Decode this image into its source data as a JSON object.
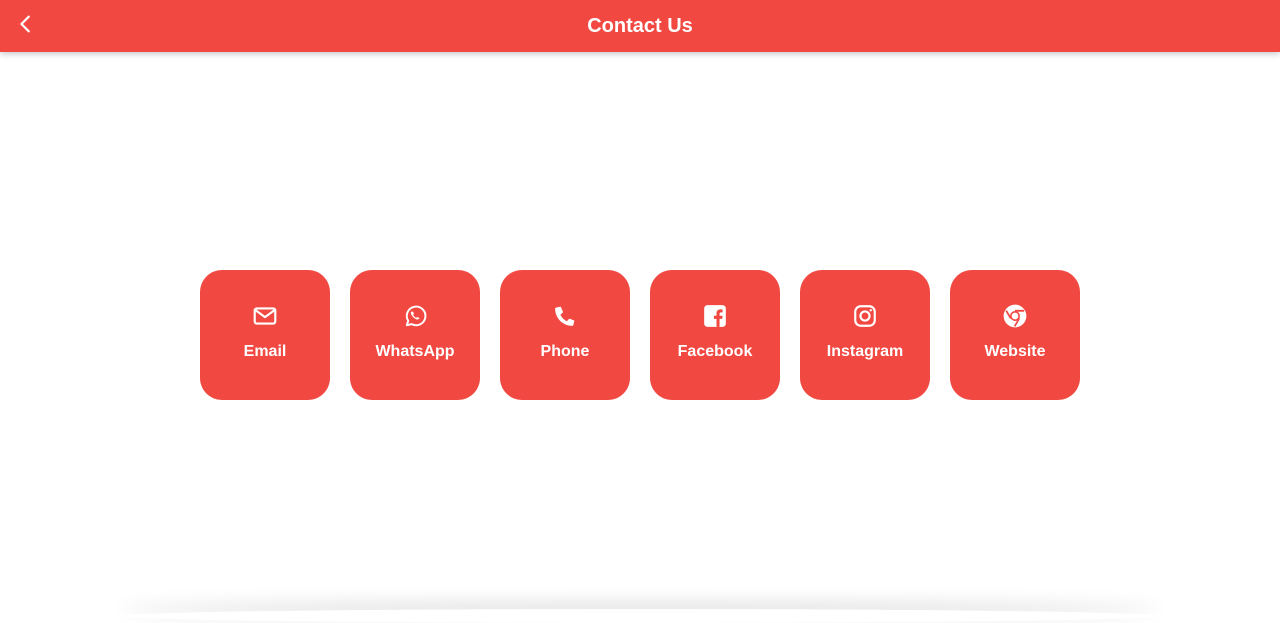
{
  "app_bar": {
    "title": "Contact Us",
    "back_icon": "chevron-left-icon",
    "background_color": "#f24842"
  },
  "contacts": [
    {
      "label": "Email",
      "icon": "mail-icon"
    },
    {
      "label": "WhatsApp",
      "icon": "whatsapp-icon"
    },
    {
      "label": "Phone",
      "icon": "phone-icon"
    },
    {
      "label": "Facebook",
      "icon": "facebook-icon"
    },
    {
      "label": "Instagram",
      "icon": "instagram-icon"
    },
    {
      "label": "Website",
      "icon": "chrome-icon"
    }
  ],
  "tile_color": "#f24842"
}
